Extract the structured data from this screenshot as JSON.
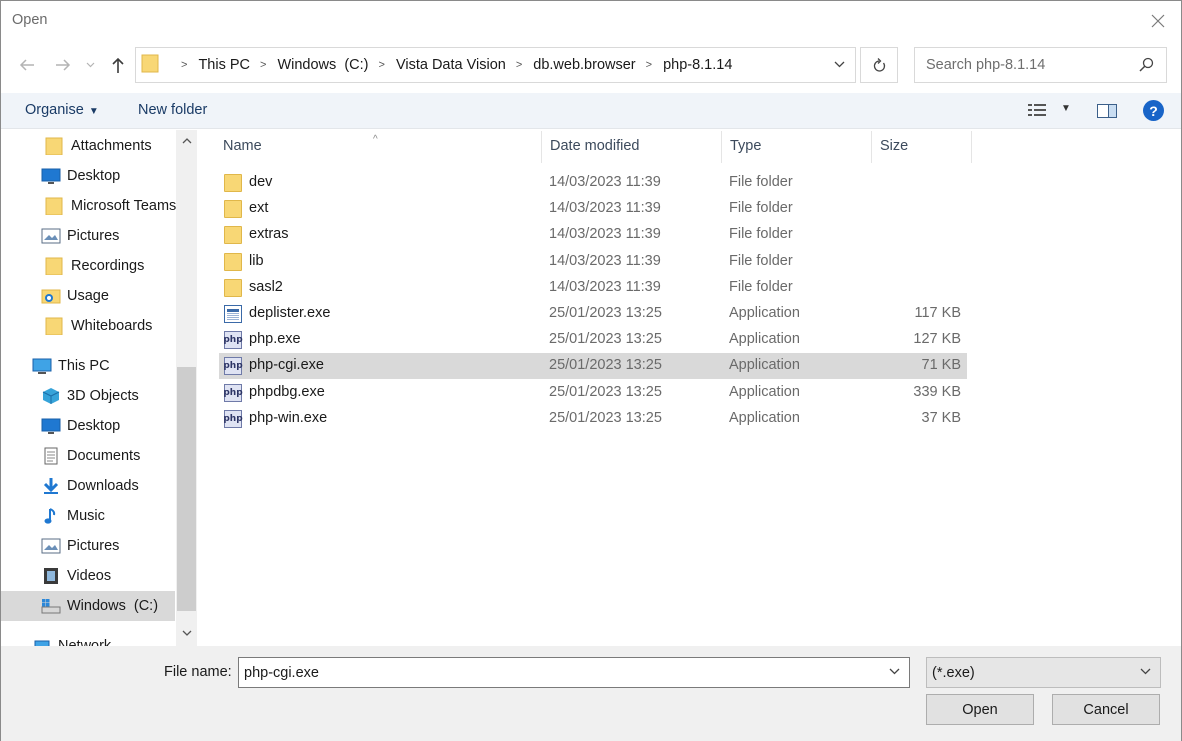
{
  "window": {
    "title": "Open",
    "close_icon": "close-icon"
  },
  "address_bar": {
    "crumbs": [
      "This PC",
      "Windows  (C:)",
      "Vista Data Vision",
      "db.web.browser",
      "php-8.1.14"
    ],
    "separator": "›"
  },
  "search": {
    "placeholder": "Search php-8.1.14"
  },
  "toolbar": {
    "organise_label": "Organise",
    "new_folder_label": "New folder"
  },
  "sidebar": {
    "items": [
      {
        "label": "Attachments",
        "icon": "folder-icon"
      },
      {
        "label": "Desktop",
        "icon": "desktop-icon"
      },
      {
        "label": "Microsoft Teams",
        "icon": "folder-icon"
      },
      {
        "label": "Pictures",
        "icon": "pictures-icon"
      },
      {
        "label": "Recordings",
        "icon": "folder-icon"
      },
      {
        "label": "Usage",
        "icon": "usage-icon"
      },
      {
        "label": "Whiteboards",
        "icon": "folder-icon"
      },
      {
        "label": "This PC",
        "icon": "pc-icon"
      },
      {
        "label": "3D Objects",
        "icon": "3d-objects-icon"
      },
      {
        "label": "Desktop",
        "icon": "desktop-icon"
      },
      {
        "label": "Documents",
        "icon": "documents-icon"
      },
      {
        "label": "Downloads",
        "icon": "downloads-icon"
      },
      {
        "label": "Music",
        "icon": "music-icon"
      },
      {
        "label": "Pictures",
        "icon": "pictures-icon"
      },
      {
        "label": "Videos",
        "icon": "videos-icon"
      },
      {
        "label": "Windows  (C:)",
        "icon": "drive-icon",
        "selected": true
      },
      {
        "label": "Network",
        "icon": "network-icon"
      }
    ]
  },
  "columns": {
    "name": "Name",
    "date": "Date modified",
    "type": "Type",
    "size": "Size"
  },
  "files": [
    {
      "name": "dev",
      "date": "14/03/2023 11:39",
      "type": "File folder",
      "size": "",
      "icon": "folder-icon"
    },
    {
      "name": "ext",
      "date": "14/03/2023 11:39",
      "type": "File folder",
      "size": "",
      "icon": "folder-icon"
    },
    {
      "name": "extras",
      "date": "14/03/2023 11:39",
      "type": "File folder",
      "size": "",
      "icon": "folder-icon"
    },
    {
      "name": "lib",
      "date": "14/03/2023 11:39",
      "type": "File folder",
      "size": "",
      "icon": "folder-icon"
    },
    {
      "name": "sasl2",
      "date": "14/03/2023 11:39",
      "type": "File folder",
      "size": "",
      "icon": "folder-icon"
    },
    {
      "name": "deplister.exe",
      "date": "25/01/2023 13:25",
      "type": "Application",
      "size": "117 KB",
      "icon": "application-icon"
    },
    {
      "name": "php.exe",
      "date": "25/01/2023 13:25",
      "type": "Application",
      "size": "127 KB",
      "icon": "php-icon"
    },
    {
      "name": "php-cgi.exe",
      "date": "25/01/2023 13:25",
      "type": "Application",
      "size": "71 KB",
      "icon": "php-icon",
      "selected": true
    },
    {
      "name": "phpdbg.exe",
      "date": "25/01/2023 13:25",
      "type": "Application",
      "size": "339 KB",
      "icon": "php-icon"
    },
    {
      "name": "php-win.exe",
      "date": "25/01/2023 13:25",
      "type": "Application",
      "size": "37 KB",
      "icon": "php-icon"
    }
  ],
  "php_icon_text": "php",
  "footer": {
    "file_name_label": "File name:",
    "file_name_value": "php-cgi.exe",
    "filter_value": "(*.exe)",
    "open_label": "Open",
    "cancel_label": "Cancel"
  }
}
